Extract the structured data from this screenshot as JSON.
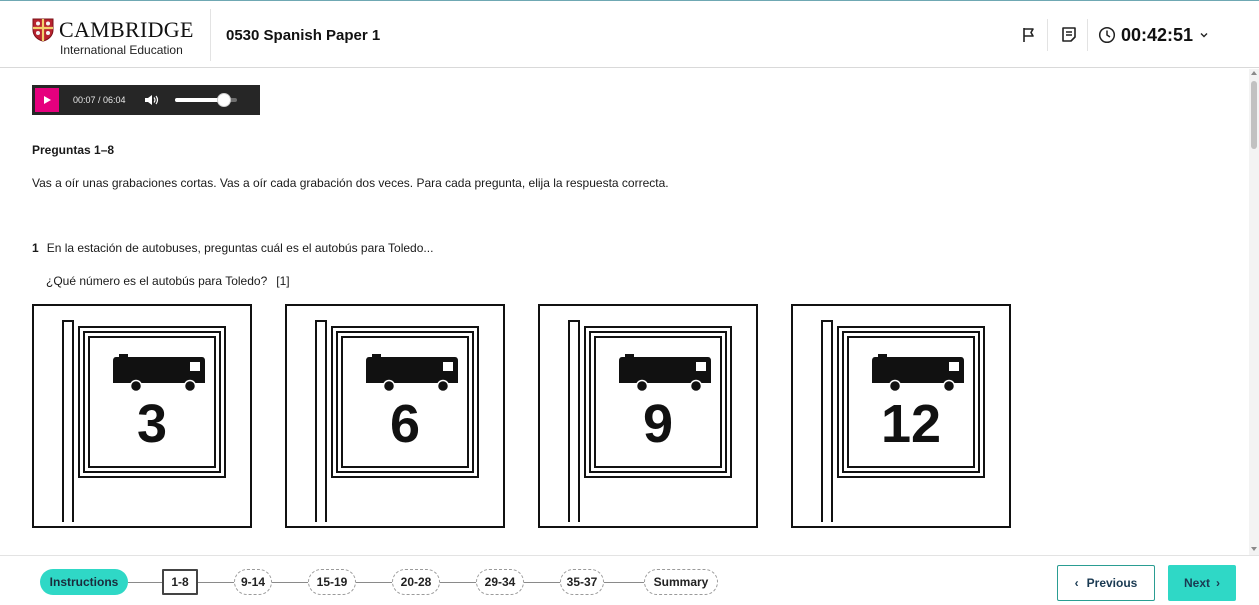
{
  "header": {
    "brand": "CAMBRIDGE",
    "brand_sub": "International Education",
    "paper_title": "0530 Spanish Paper 1",
    "timer": "00:42:51",
    "icons": [
      "flag-icon",
      "notes-icon",
      "clock-icon",
      "chevron-down-icon"
    ]
  },
  "audio": {
    "current": "00:07",
    "duration": "06:04",
    "time_display": "00:07 / 06:04",
    "volume_level": 0.8
  },
  "section": {
    "heading": "Preguntas 1–8",
    "instructions": "Vas a oír unas grabaciones cortas. Vas a oír cada grabación dos veces. Para cada pregunta, elija la respuesta correcta."
  },
  "question": {
    "number": "1",
    "text": "En la estación de autobuses, preguntas cuál es el autobús para Toledo...",
    "prompt": "¿Qué número es el autobús para Toledo?",
    "marks": "[1]",
    "options": [
      "3",
      "6",
      "9",
      "12"
    ]
  },
  "footer": {
    "nav": [
      "Instructions",
      "1-8",
      "9-14",
      "15-19",
      "20-28",
      "29-34",
      "35-37",
      "Summary"
    ],
    "previous": "Previous",
    "next": "Next"
  },
  "colors": {
    "accent": "#2fd8c6",
    "play_button": "#e6007e",
    "player_bg": "#262626"
  }
}
